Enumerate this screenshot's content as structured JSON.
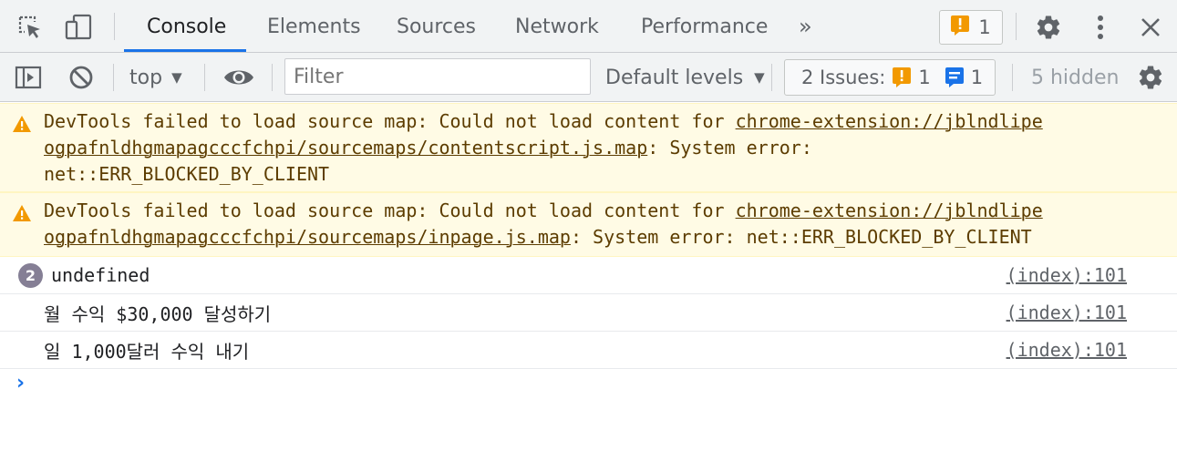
{
  "tabs": [
    {
      "label": "Console",
      "active": true
    },
    {
      "label": "Elements",
      "active": false
    },
    {
      "label": "Sources",
      "active": false
    },
    {
      "label": "Network",
      "active": false
    },
    {
      "label": "Performance",
      "active": false
    }
  ],
  "more_tabs_glyph": "»",
  "warnings_badge": {
    "count": "1"
  },
  "toolbar": {
    "context": "top",
    "filter_placeholder": "Filter",
    "levels": "Default levels",
    "issues_label": "2 Issues:",
    "issues_warning_count": "1",
    "issues_info_count": "1",
    "hidden": "5 hidden"
  },
  "messages": [
    {
      "type": "warning",
      "prefix": "DevTools failed to load source map: Could not load content for ",
      "line1_link": "chrome-extension://jblndlipe",
      "line2_link": "ogpafnldhgmapagcccfchpi/sourcemaps/contentscript.js.map",
      "line2_after": ": System error:",
      "line3": "net::ERR_BLOCKED_BY_CLIENT"
    },
    {
      "type": "warning",
      "prefix": "DevTools failed to load source map: Could not load content for ",
      "line1_link": "chrome-extension://jblndlipe",
      "line2_link": "ogpafnldhgmapagcccfchpi/sourcemaps/inpage.js.map",
      "line2_after": ": System error: net::ERR_BLOCKED_BY_CLIENT"
    },
    {
      "type": "log",
      "repeat": "2",
      "text": "undefined",
      "source": "(index):101"
    },
    {
      "type": "log",
      "text": "월 수익 $30,000 달성하기",
      "source": "(index):101"
    },
    {
      "type": "log",
      "text": "일 1,000달러 수익 내기",
      "source": "(index):101"
    }
  ],
  "prompt_glyph": "›",
  "colors": {
    "accent": "#1a73e8",
    "warning_bg": "#fffbe5",
    "warning_text": "#5c3c00",
    "warning_icon": "#f29900",
    "toolbar_bg": "#f1f3f4"
  },
  "icons": [
    "inspect-element-icon",
    "device-toolbar-icon",
    "more-tabs-icon",
    "warning-icon",
    "settings-gear-icon",
    "kebab-menu-icon",
    "close-icon",
    "sidebar-toggle-icon",
    "clear-console-icon",
    "dropdown-caret-icon",
    "eye-icon",
    "info-message-icon",
    "console-prompt-icon"
  ]
}
